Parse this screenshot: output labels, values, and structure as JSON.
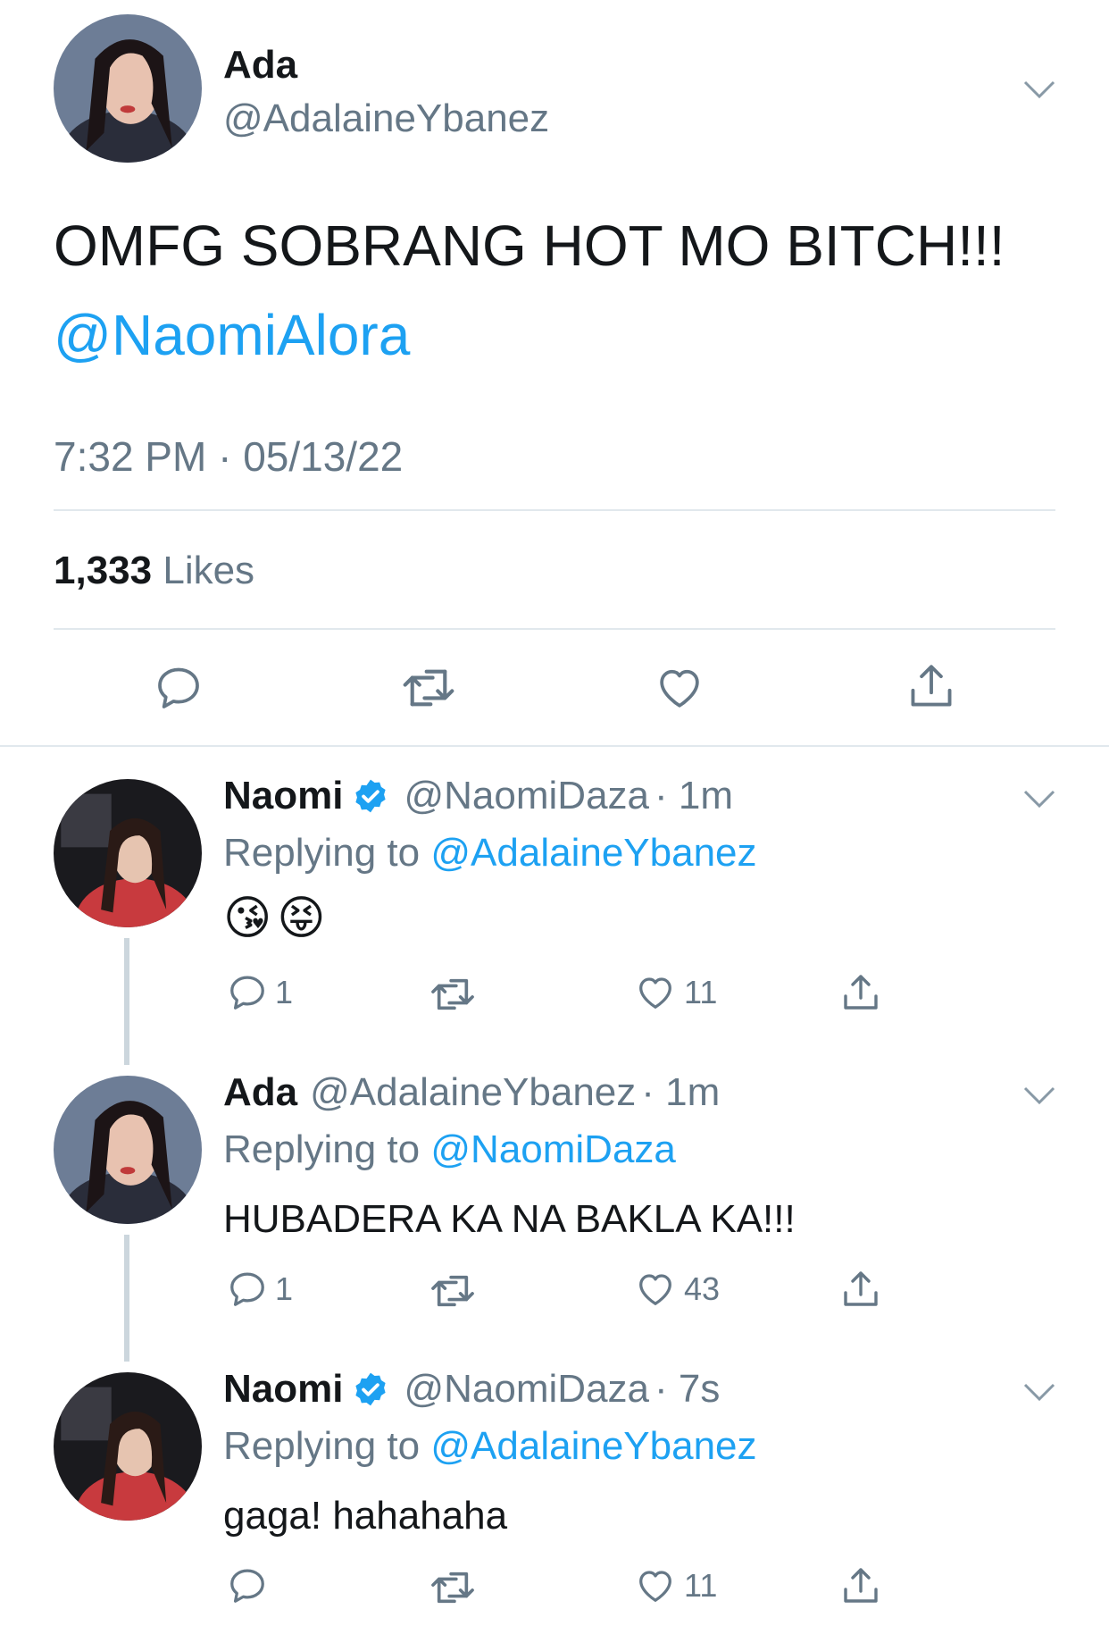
{
  "main_tweet": {
    "name": "Ada",
    "handle": "@AdalaineYbanez",
    "text": "OMFG SOBRANG HOT MO BITCH!!!",
    "mention": "@NaomiAlora",
    "timestamp": "7:32 PM · 05/13/22",
    "likes_count": "1,333",
    "likes_label": "Likes"
  },
  "replies": [
    {
      "name": "Naomi",
      "verified": true,
      "handle": "@NaomiDaza",
      "time": "· 1m",
      "replying_label": "Replying to",
      "replying_to": "@AdalaineYbanez",
      "text": "😘😝",
      "reply_count": "1",
      "like_count": "11"
    },
    {
      "name": "Ada",
      "verified": false,
      "handle": "@AdalaineYbanez",
      "time": "· 1m",
      "replying_label": "Replying to",
      "replying_to": "@NaomiDaza",
      "text": "HUBADERA KA NA BAKLA KA!!!",
      "reply_count": "1",
      "like_count": "43"
    },
    {
      "name": "Naomi",
      "verified": true,
      "handle": "@NaomiDaza",
      "time": "· 7s",
      "replying_label": "Replying to",
      "replying_to": "@AdalaineYbanez",
      "text": "gaga! hahahaha",
      "reply_count": "",
      "like_count": "11"
    }
  ],
  "colors": {
    "accent": "#1da1f2",
    "muted": "#657786",
    "divider": "#e1e8ed"
  },
  "icons": [
    "chevron-down-icon",
    "reply-icon",
    "retweet-icon",
    "like-icon",
    "share-icon",
    "verified-icon"
  ]
}
